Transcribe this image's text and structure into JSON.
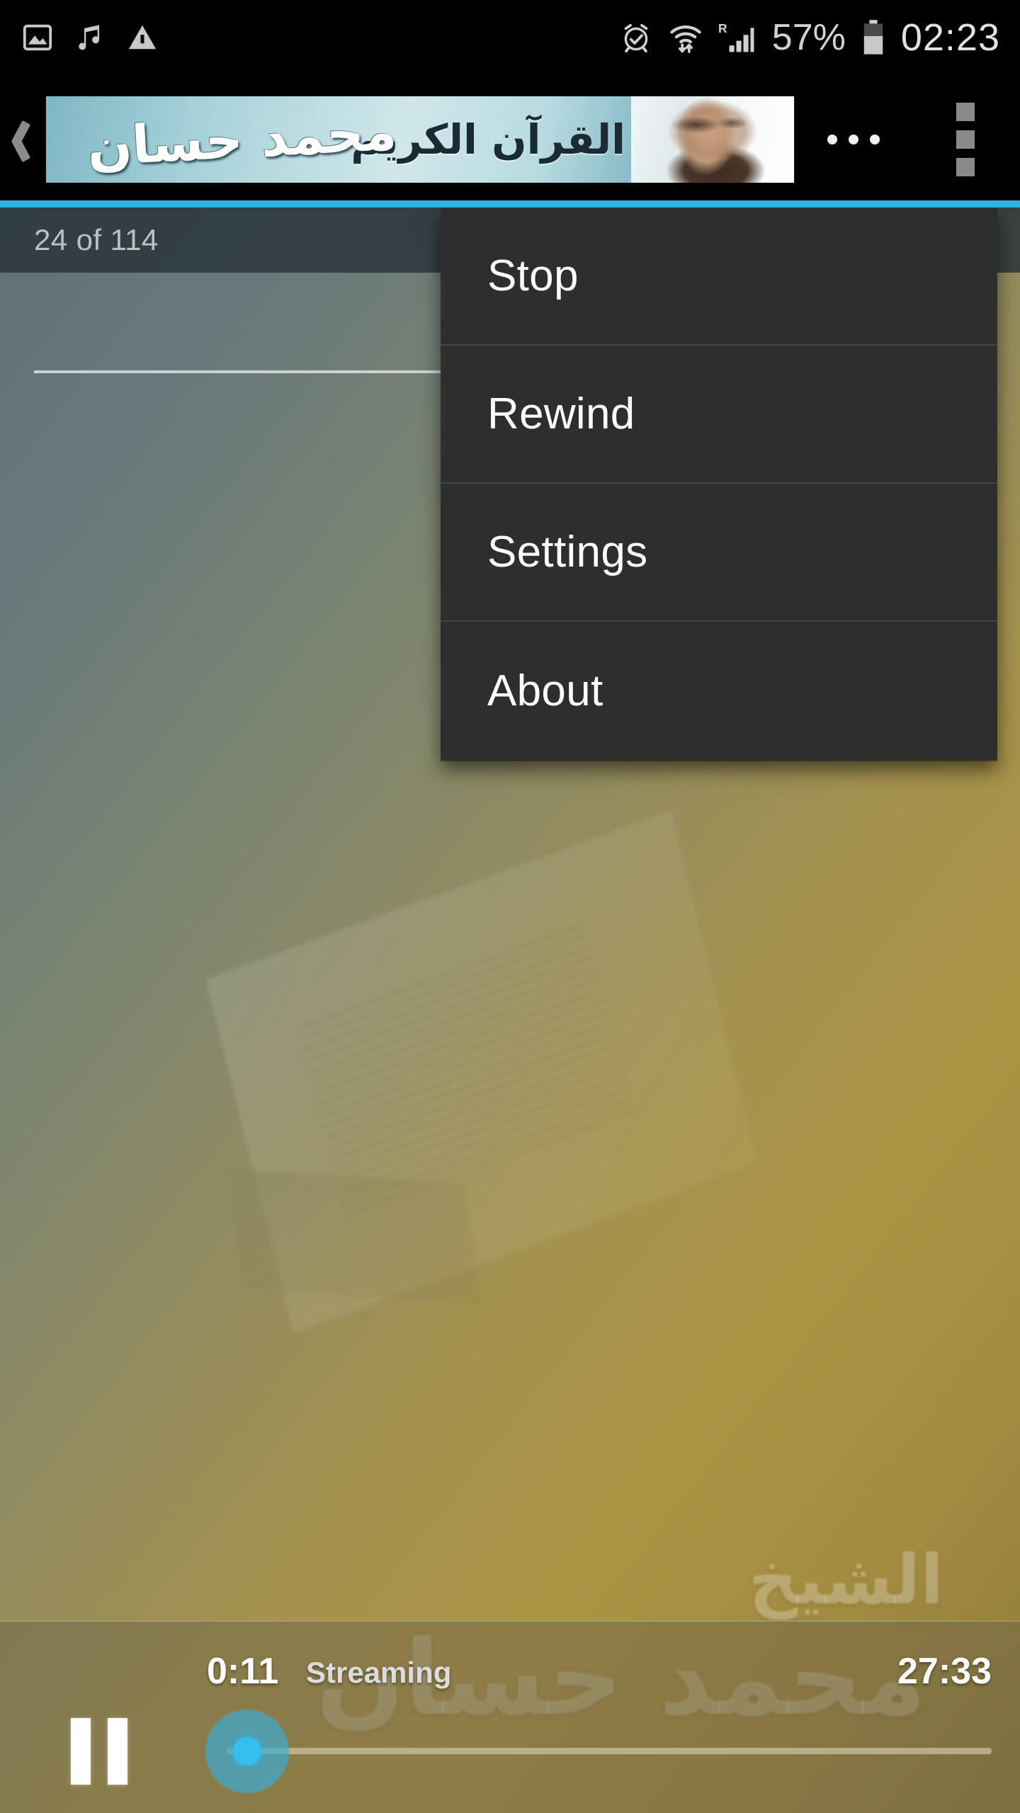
{
  "status_bar": {
    "icons_left": [
      "image-icon",
      "music-note-icon",
      "warning-triangle-icon"
    ],
    "icons_right": [
      "alarm-clock-icon",
      "wifi-transfer-icon",
      "roaming-signal-icon",
      "battery-icon"
    ],
    "roaming_label": "R",
    "battery_percent": "57%",
    "clock": "02:23"
  },
  "header": {
    "back_icon": "back-chevron-icon",
    "ad_main_text": "القرآن الكريم",
    "ad_name_text": "محمد حسان",
    "ad_more_dots": "…",
    "overflow_icon": "overflow-menu-icon",
    "accent_color": "#2fb3e0"
  },
  "list": {
    "counter": "24 of 114"
  },
  "menu": {
    "items": [
      {
        "label": "Stop"
      },
      {
        "label": "Rewind"
      },
      {
        "label": "Settings"
      },
      {
        "label": "About"
      }
    ]
  },
  "background": {
    "watermark_title": "الشيخ",
    "watermark_name": "محمد حسان"
  },
  "player": {
    "elapsed": "0:11",
    "status": "Streaming",
    "duration": "27:33",
    "transport_icon": "pause-icon",
    "seek_icon": "seek-thumb",
    "thumb_color": "#35bef0",
    "progress_percent": 0.7
  }
}
